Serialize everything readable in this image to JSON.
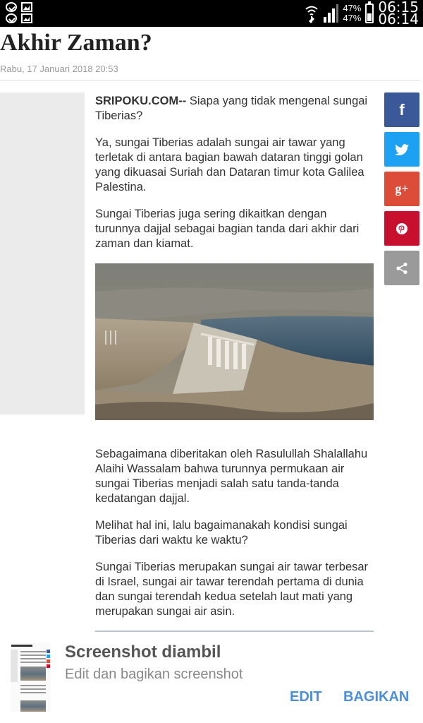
{
  "status_bar": {
    "battery_top": "47%",
    "battery_bottom": "47%",
    "time_top": "06:15",
    "time_bottom": "06:14",
    "battery_level": 0.47
  },
  "article": {
    "title": "Akhir Zaman?",
    "date": "Rabu, 17 Januari 2018 20:53",
    "brand": "SRIPOKU.COM--",
    "intro": " Siapa yang tidak mengenal sungai Tiberias?",
    "paragraphs_top": [
      "Ya, sungai Tiberias adalah sungai air tawar yang terletak di antara bagian bawah dataran tinggi golan yang dikuasai Suriah dan Dataran timur kota Galilea Palestina.",
      "Sungai Tiberias juga sering dikaitkan dengan turunnya dajjal sebagai bagian tanda dari akhir dari zaman dan kiamat."
    ],
    "paragraphs_bottom": [
      "Sebagaimana diberitakan oleh Rasulullah Shalallahu Alaihi Wassalam bahwa turunnya permukaan air sungai Tiberias menjadi salah satu tanda-tanda kedatangan dajjal.",
      "Melihat hal ini, lalu bagaimanakah kondisi sungai Tiberias dari waktu ke waktu?",
      "Sungai Tiberias merupakan sungai air tawar terbesar di Israel, sungai air tawar terendah pertama di dunia dan sungai terendah kedua setelah laut mati yang merupakan sungai air asin."
    ]
  },
  "share_buttons": {
    "facebook": "f",
    "googleplus": "g+"
  },
  "notification": {
    "title": "Screenshot diambil",
    "subtitle": "Edit dan bagikan screenshot",
    "edit_label": "EDIT",
    "share_label": "BAGIKAN"
  },
  "colors": {
    "facebook": "#3b5998",
    "twitter": "#1da1f2",
    "googleplus": "#dd4b39",
    "pinterest": "#c8102e",
    "share": "#9a9a9a",
    "action": "#4a8ee0"
  }
}
